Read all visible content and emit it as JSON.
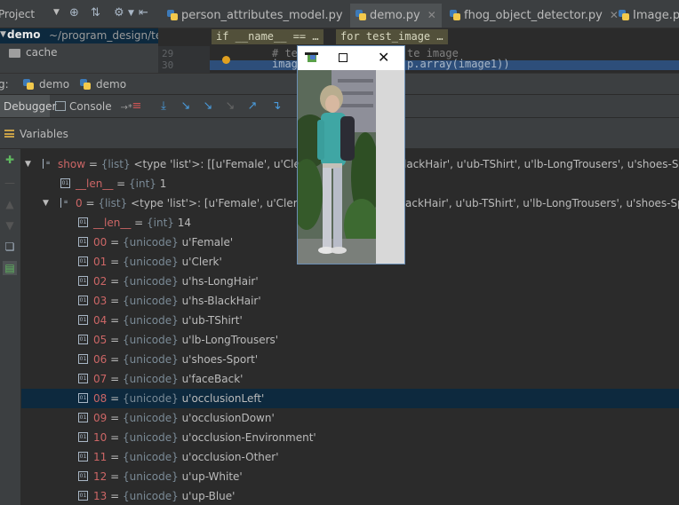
{
  "project": {
    "label": "Project",
    "root_name": "demo",
    "root_path": "~/program_design/te",
    "cache_folder": "cache"
  },
  "editor_tabs": [
    {
      "label": "person_attributes_model.py",
      "active": false
    },
    {
      "label": "demo.py",
      "active": true
    },
    {
      "label": "fhog_object_detector.py",
      "active": false
    },
    {
      "label": "Image.py",
      "active": false
    }
  ],
  "editor": {
    "crumb1": "if __name__ == …",
    "crumb2": "for test_image …",
    "line_numbers": [
      "29",
      "30"
    ],
    "line29_text": "# te",
    "line29_tail": "te image",
    "line30_text": "imag",
    "line30_tail": "p.array(image1))"
  },
  "debug": {
    "bar_label": "g:",
    "run_tabs": [
      "demo",
      "demo"
    ],
    "tab_debugger": "Debugger",
    "tab_console": "Console",
    "console_arrow": "→*",
    "variables_title": "Variables"
  },
  "variables": [
    {
      "name": "show",
      "type": "{list}",
      "value": "<type 'list'>: [[u'Female', u'Clerk', u'hs-LongHair', u'hs-BlackHair', u'ub-TShirt', u'lb-LongTrousers', u'shoes-Sport'",
      "tree_value_visible_left": "<type 'list'>: [[u'Female', u'Clerk', u'",
      "tree_value_visible_right": "lackHair', u'ub-TShirt', u'lb-LongTrousers', u'shoes-Spo"
    },
    {
      "name": "__len__",
      "type": "{int}",
      "value": "1"
    },
    {
      "name": "0",
      "type": "{list}",
      "value_left": "<type 'list'>: [u'Female', u'Clerk', u'",
      "value_right": "ackHair', u'ub-TShirt', u'lb-LongTrousers', u'shoes-Spo"
    },
    {
      "name": "__len__",
      "type": "{int}",
      "value": "14"
    },
    {
      "name": "00",
      "type": "{unicode}",
      "value": "u'Female'"
    },
    {
      "name": "01",
      "type": "{unicode}",
      "value": "u'Clerk'"
    },
    {
      "name": "02",
      "type": "{unicode}",
      "value": "u'hs-LongHair'"
    },
    {
      "name": "03",
      "type": "{unicode}",
      "value": "u'hs-BlackHair'"
    },
    {
      "name": "04",
      "type": "{unicode}",
      "value": "u'ub-TShirt'"
    },
    {
      "name": "05",
      "type": "{unicode}",
      "value": "u'lb-LongTrousers'"
    },
    {
      "name": "06",
      "type": "{unicode}",
      "value": "u'shoes-Sport'"
    },
    {
      "name": "07",
      "type": "{unicode}",
      "value": "u'faceBack'"
    },
    {
      "name": "08",
      "type": "{unicode}",
      "value": "u'occlusionLeft'"
    },
    {
      "name": "09",
      "type": "{unicode}",
      "value": "u'occlusionDown'"
    },
    {
      "name": "10",
      "type": "{unicode}",
      "value": "u'occlusion-Environment'"
    },
    {
      "name": "11",
      "type": "{unicode}",
      "value": "u'occlusion-Other'"
    },
    {
      "name": "12",
      "type": "{unicode}",
      "value": "u'up-White'"
    },
    {
      "name": "13",
      "type": "{unicode}",
      "value": "u'up-Blue'"
    }
  ],
  "selected_variable": "08",
  "colors": {
    "background": "#2b2b2b",
    "panel": "#3c3f41",
    "selection": "#0d293e",
    "var_name": "#cc6666",
    "type_hint": "#7a8a96"
  },
  "image_window": {
    "controls": [
      "app-icon",
      "maximize-icon",
      "close-icon"
    ],
    "content": "pedestrian photo: woman with light hair, teal jacket, dark backpack, light jeans"
  }
}
